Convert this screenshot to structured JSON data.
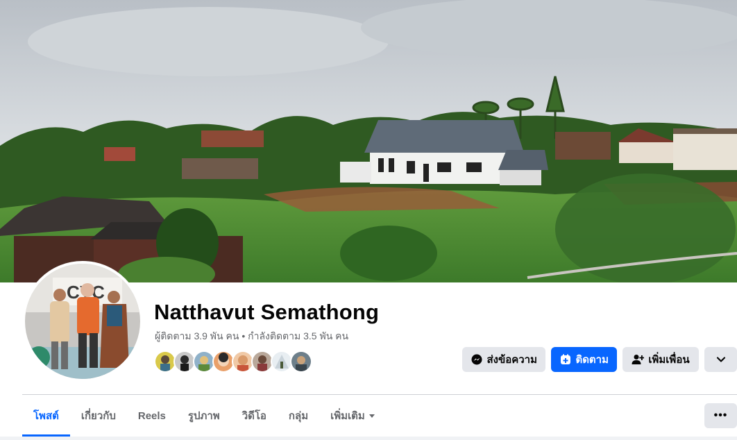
{
  "profile": {
    "name": "Natthavut Semathong",
    "followers_text": "ผู้ติดตาม 3.9 พัน คน",
    "separator": " • ",
    "following_text": "กำลังติดตาม 3.5 พัน คน"
  },
  "actions": {
    "message_label": "ส่งข้อความ",
    "follow_label": "ติดตาม",
    "add_friend_label": "เพิ่มเพื่อน",
    "expand_icon": "chevron-down-icon"
  },
  "tabs": [
    {
      "label": "โพสต์",
      "active": true
    },
    {
      "label": "เกี่ยวกับ",
      "active": false
    },
    {
      "label": "Reels",
      "active": false
    },
    {
      "label": "รูปภาพ",
      "active": false
    },
    {
      "label": "วิดีโอ",
      "active": false
    },
    {
      "label": "กลุ่ม",
      "active": false
    },
    {
      "label": "เพิ่มเติม",
      "active": false
    }
  ],
  "more_options_label": "•••",
  "colors": {
    "accent": "#0866ff",
    "button_grey": "#e4e6eb",
    "secondary_text": "#65676b"
  }
}
